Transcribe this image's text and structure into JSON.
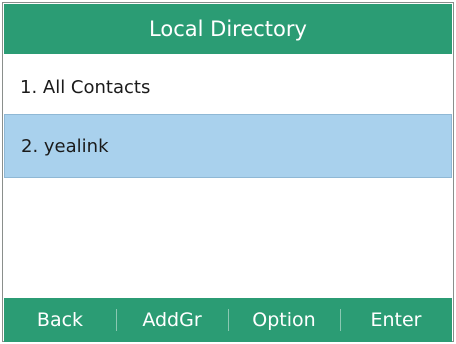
{
  "header": {
    "title": "Local Directory"
  },
  "list": {
    "items": [
      {
        "label": "1. All Contacts",
        "selected": false
      },
      {
        "label": "2. yealink",
        "selected": true
      }
    ]
  },
  "softkeys": {
    "back": "Back",
    "addgr": "AddGr",
    "option": "Option",
    "enter": "Enter"
  },
  "colors": {
    "accent": "#2b9c74",
    "selection": "#a9d1ed",
    "text": "#1a1a1a",
    "header_text": "#ffffff"
  }
}
